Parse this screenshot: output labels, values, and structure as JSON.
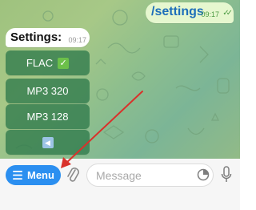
{
  "outgoing_message": {
    "text": "/settings",
    "time": "09:17",
    "status": "✓✓"
  },
  "incoming_message": {
    "text": "Settings:",
    "time": "09:17"
  },
  "inline_keyboard": {
    "flac_label": "FLAC",
    "flac_selected_emoji": "✓",
    "mp3_320_label": "MP3 320",
    "mp3_128_label": "MP3 128",
    "back_emoji": "◀"
  },
  "input_bar": {
    "menu_label": "Menu",
    "message_placeholder": "Message"
  },
  "colors": {
    "menu_button": "#2b8ff0",
    "keyboard_button": "#307a4c",
    "arrow": "#d9312b",
    "outgoing_bubble": "#e6f7cf"
  }
}
